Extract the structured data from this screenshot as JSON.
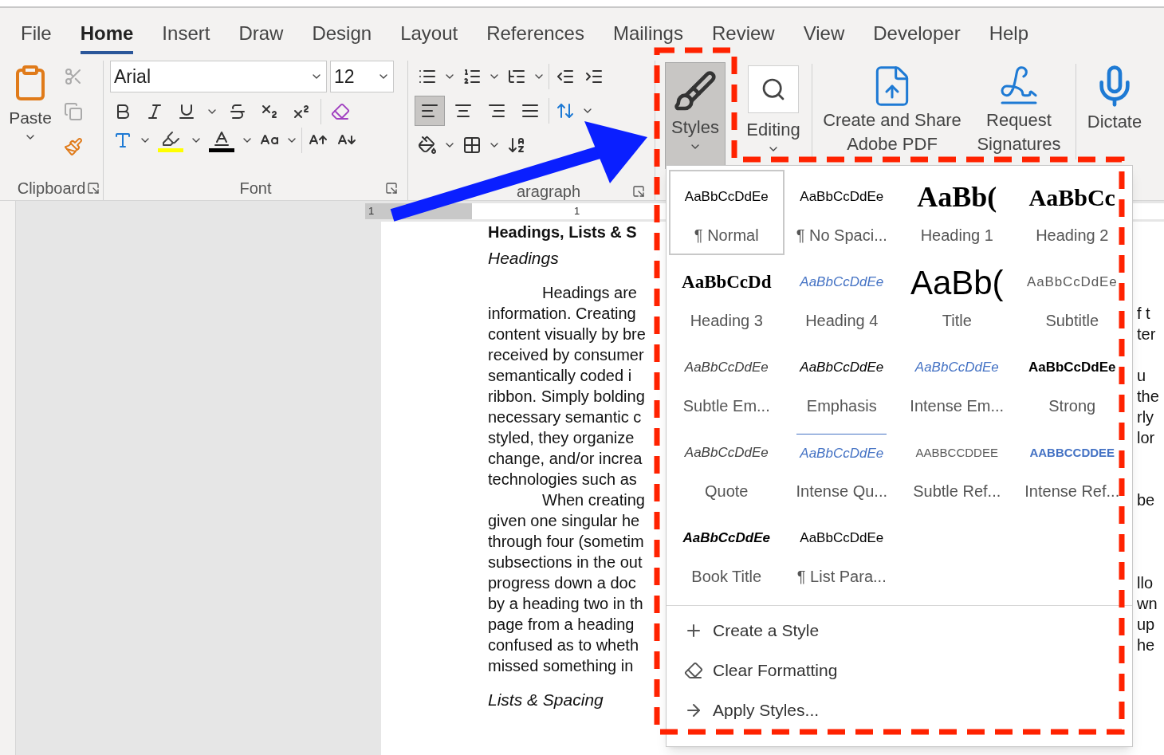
{
  "tabs": [
    {
      "label": "File",
      "selected": false
    },
    {
      "label": "Home",
      "selected": true
    },
    {
      "label": "Insert",
      "selected": false
    },
    {
      "label": "Draw",
      "selected": false
    },
    {
      "label": "Design",
      "selected": false
    },
    {
      "label": "Layout",
      "selected": false
    },
    {
      "label": "References",
      "selected": false
    },
    {
      "label": "Mailings",
      "selected": false
    },
    {
      "label": "Review",
      "selected": false
    },
    {
      "label": "View",
      "selected": false
    },
    {
      "label": "Developer",
      "selected": false
    },
    {
      "label": "Help",
      "selected": false
    }
  ],
  "clipboard": {
    "paste": "Paste",
    "label": "Clipboard"
  },
  "font": {
    "family": "Arial",
    "size": "12",
    "label": "Font"
  },
  "paragraph": {
    "label": "aragraph",
    "align": [
      {
        "kind": "left",
        "selected": true
      },
      {
        "kind": "center",
        "selected": false
      },
      {
        "kind": "right",
        "selected": false
      },
      {
        "kind": "justify",
        "selected": false
      }
    ]
  },
  "styles_button": {
    "label": "Styles",
    "selected": true
  },
  "editing": {
    "label": "Editing"
  },
  "adobe": {
    "lines": [
      "Create and Share",
      "Adobe PDF"
    ]
  },
  "signatures": {
    "lines": [
      "Request",
      "Signatures"
    ]
  },
  "dictate": {
    "label": "Dictate"
  },
  "ruler": {
    "labels": [
      "1",
      "1"
    ]
  },
  "document": {
    "title": "Headings, Lists & S",
    "heading": "Headings",
    "subheading": "Lists & Spacing",
    "lines": [
      {
        "text": "Headings are",
        "indent": true
      },
      {
        "text": "information. Creating",
        "indent": false,
        "tail": "f t"
      },
      {
        "text": "content visually by bre",
        "indent": false,
        "tail": "ter"
      },
      {
        "text": "received by consumer",
        "indent": false
      },
      {
        "text": "semantically coded i",
        "indent": false,
        "tail": "u"
      },
      {
        "text": "ribbon. Simply bolding",
        "indent": false,
        "tail": "the"
      },
      {
        "text": "necessary semantic c",
        "indent": false,
        "tail": "rly"
      },
      {
        "text": "styled, they organize",
        "indent": false,
        "tail": "lor"
      },
      {
        "text": "change, and/or increa",
        "indent": false
      },
      {
        "text": "technologies such as",
        "indent": false
      },
      {
        "text": "When creating",
        "indent": true,
        "tail": "be"
      },
      {
        "text": "given one singular he",
        "indent": false
      },
      {
        "text": "through four (sometim",
        "indent": false
      },
      {
        "text": "subsections in the out",
        "indent": false
      },
      {
        "text": "progress down a doc",
        "indent": false,
        "tail": "llo"
      },
      {
        "text": "by a heading two in th",
        "indent": false,
        "tail": "wn"
      },
      {
        "text": "page from a heading",
        "indent": false,
        "tail": "up"
      },
      {
        "text": "confused as to wheth",
        "indent": false,
        "tail": "he"
      },
      {
        "text": "missed something in",
        "indent": false
      }
    ]
  },
  "styles_gallery": {
    "items": [
      {
        "kind": "normal",
        "preview": "AaBbCcDdEe",
        "name": "¶ Normal",
        "selected": true
      },
      {
        "kind": "normal",
        "preview": "AaBbCcDdEe",
        "name": "¶ No Spaci...",
        "selected": false
      },
      {
        "kind": "heading1",
        "preview": "AaBb(",
        "name": "Heading 1",
        "selected": false
      },
      {
        "kind": "heading2",
        "preview": "AaBbCc",
        "name": "Heading 2",
        "selected": false
      },
      {
        "kind": "heading3",
        "preview": "AaBbCcDd",
        "name": "Heading 3",
        "selected": false
      },
      {
        "kind": "heading4",
        "preview": "AaBbCcDdEe",
        "name": "Heading 4",
        "selected": false
      },
      {
        "kind": "title",
        "preview": "AaBb(",
        "name": "Title",
        "selected": false
      },
      {
        "kind": "subtitle",
        "preview": "AaBbCcDdEe",
        "name": "Subtitle",
        "selected": false
      },
      {
        "kind": "subtle_emphasis",
        "preview": "AaBbCcDdEe",
        "name": "Subtle Em...",
        "selected": false
      },
      {
        "kind": "emphasis",
        "preview": "AaBbCcDdEe",
        "name": "Emphasis",
        "selected": false
      },
      {
        "kind": "intense_emphasis",
        "preview": "AaBbCcDdEe",
        "name": "Intense Em...",
        "selected": false
      },
      {
        "kind": "strong",
        "preview": "AaBbCcDdEe",
        "name": "Strong",
        "selected": false
      },
      {
        "kind": "quote",
        "preview": "AaBbCcDdEe",
        "name": "Quote",
        "selected": false
      },
      {
        "kind": "intense_quote",
        "preview": "AaBbCcDdEe",
        "name": "Intense Qu...",
        "selected": false
      },
      {
        "kind": "subtle_reference",
        "preview": "AABBCCDDEE",
        "name": "Subtle Ref...",
        "selected": false
      },
      {
        "kind": "intense_reference",
        "preview": "AABBCCDDEE",
        "name": "Intense Ref...",
        "selected": false
      },
      {
        "kind": "book_title",
        "preview": "AaBbCcDdEe",
        "name": "Book Title",
        "selected": false
      },
      {
        "kind": "normal",
        "preview": "AaBbCcDdEe",
        "name": "¶ List Para...",
        "selected": false
      }
    ],
    "commands": [
      {
        "kind": "create",
        "label": "Create a Style"
      },
      {
        "kind": "clear",
        "label": "Clear Formatting"
      },
      {
        "kind": "apply",
        "label": "Apply Styles..."
      }
    ]
  }
}
